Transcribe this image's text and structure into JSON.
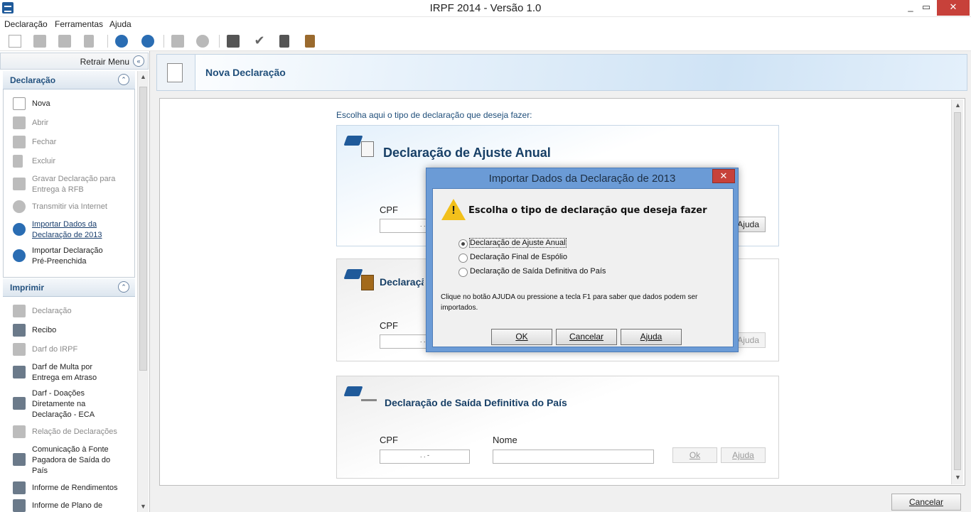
{
  "window": {
    "title": "IRPF 2014 - Versão 1.0",
    "minimize": "_",
    "maximize": "▭",
    "close": "✕"
  },
  "menu": {
    "declaracao": "Declaração",
    "ferramentas": "Ferramentas",
    "ajuda": "Ajuda"
  },
  "sidebar": {
    "retrair_label": "Retrair Menu",
    "declaracao_section": {
      "title": "Declaração",
      "items": [
        {
          "label": "Nova",
          "icon": "new-doc-icon"
        },
        {
          "label": "Abrir",
          "icon": "open-folder-icon"
        },
        {
          "label": "Fechar",
          "icon": "folder-icon"
        },
        {
          "label": "Excluir",
          "icon": "trash-icon"
        },
        {
          "label": "Gravar Declaração para Entrega à RFB",
          "icon": "save-disk-icon"
        },
        {
          "label": "Transmitir via Internet",
          "icon": "globe-icon"
        },
        {
          "label": "Importar Dados da Declaração de 2013",
          "icon": "import-icon"
        },
        {
          "label": "Importar Declaração Pré-Preenchida",
          "icon": "import-prefilled-icon"
        }
      ]
    },
    "imprimir_section": {
      "title": "Imprimir",
      "items": [
        {
          "label": "Declaração",
          "icon": "printer-icon"
        },
        {
          "label": "Recibo",
          "icon": "printer-icon"
        },
        {
          "label": "Darf do IRPF",
          "icon": "printer-icon"
        },
        {
          "label": "Darf de Multa por Entrega em Atraso",
          "icon": "printer-icon"
        },
        {
          "label": "Darf - Doações Diretamente na Declaração - ECA",
          "icon": "printer-icon"
        },
        {
          "label": "Relação de Declarações",
          "icon": "printer-icon"
        },
        {
          "label": "Comunicação à Fonte Pagadora de Saída do País",
          "icon": "printer-icon"
        },
        {
          "label": "Informe de Rendimentos",
          "icon": "printer-icon"
        },
        {
          "label": "Informe de Plano de",
          "icon": "printer-icon"
        }
      ]
    }
  },
  "header": {
    "title": "Nova Declaração"
  },
  "main": {
    "choose_label": "Escolha aqui o tipo de declaração que deseja fazer:",
    "cards": [
      {
        "title": "Declaração de Ajuste Anual",
        "cpf_label": "CPF",
        "cpf_value": ". . -",
        "btn_ajuda": "Ajuda"
      },
      {
        "title": "Declaração Final de Espólio",
        "cpf_label": "CPF",
        "cpf_value": ". . -",
        "btn_ajuda": "Ajuda"
      },
      {
        "title": "Declaração de Saída Definitiva do País",
        "cpf_label": "CPF",
        "cpf_value": ". . -",
        "nome_label": "Nome",
        "btn_ok": "Ok",
        "btn_ajuda": "Ajuda"
      }
    ],
    "cancel_button": "Cancelar"
  },
  "modal": {
    "title": "Importar Dados da Declaração de 2013",
    "heading": "Escolha o tipo de declaração que deseja fazer",
    "options": [
      {
        "label": "Declaração de Ajuste Anual",
        "selected": true
      },
      {
        "label": "Declaração Final de Espólio",
        "selected": false
      },
      {
        "label": "Declaração de Saída Definitiva do País",
        "selected": false
      }
    ],
    "info": "Clique no botão AJUDA ou pressione a tecla F1 para saber que dados podem ser importados.",
    "ok": "OK",
    "cancelar": "Cancelar",
    "ajuda": "Ajuda",
    "close": "✕"
  },
  "colors": {
    "accent": "#1f4e7a",
    "close_red": "#c7413a",
    "modal_frame": "#6b9bd6"
  }
}
